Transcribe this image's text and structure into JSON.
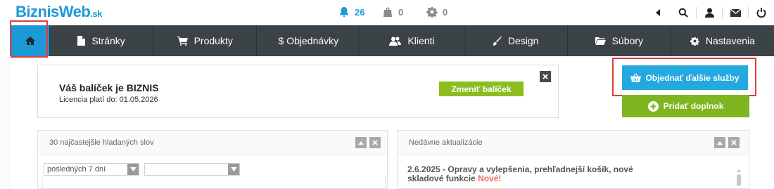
{
  "brand": {
    "name": "BiznisWeb",
    "tld": ".sk"
  },
  "notifications": {
    "bell_count": "26",
    "bag_count": "0",
    "gear_count": "0"
  },
  "nav": [
    {
      "label": "Stránky",
      "icon": "file-icon"
    },
    {
      "label": "Produkty",
      "icon": "cart-icon"
    },
    {
      "label": "$ Objednávky",
      "icon": "dollar-icon"
    },
    {
      "label": "Klienti",
      "icon": "users-icon"
    },
    {
      "label": "Design",
      "icon": "brush-icon"
    },
    {
      "label": "Súbory",
      "icon": "folder-icon"
    },
    {
      "label": "Nastavenia",
      "icon": "gear-icon"
    }
  ],
  "package": {
    "title": "Váš balíček je BIZNIS",
    "license": "Licencia platí do: 01.05.2026",
    "change_label": "Zmeniť balíček"
  },
  "actions": {
    "order_label": "Objednať ďalšie služby",
    "addon_label": "Pridať doplnok"
  },
  "panel_search": {
    "title": "30 najčastejšie hladaných slov",
    "period_value": "posledných 7 dní",
    "second_select_value": ""
  },
  "panel_updates": {
    "title": "Nedávne aktualizácie",
    "news_text": "2.6.2025 - Opravy a vylepšenia, prehľadnejší košík, nové skladové funkcie",
    "news_badge": "Nové!"
  },
  "colors": {
    "brand_blue": "#1e9ad6",
    "nav_bg": "#3c4347",
    "green": "#8bbd1f",
    "highlight_red": "#e23b3b"
  }
}
